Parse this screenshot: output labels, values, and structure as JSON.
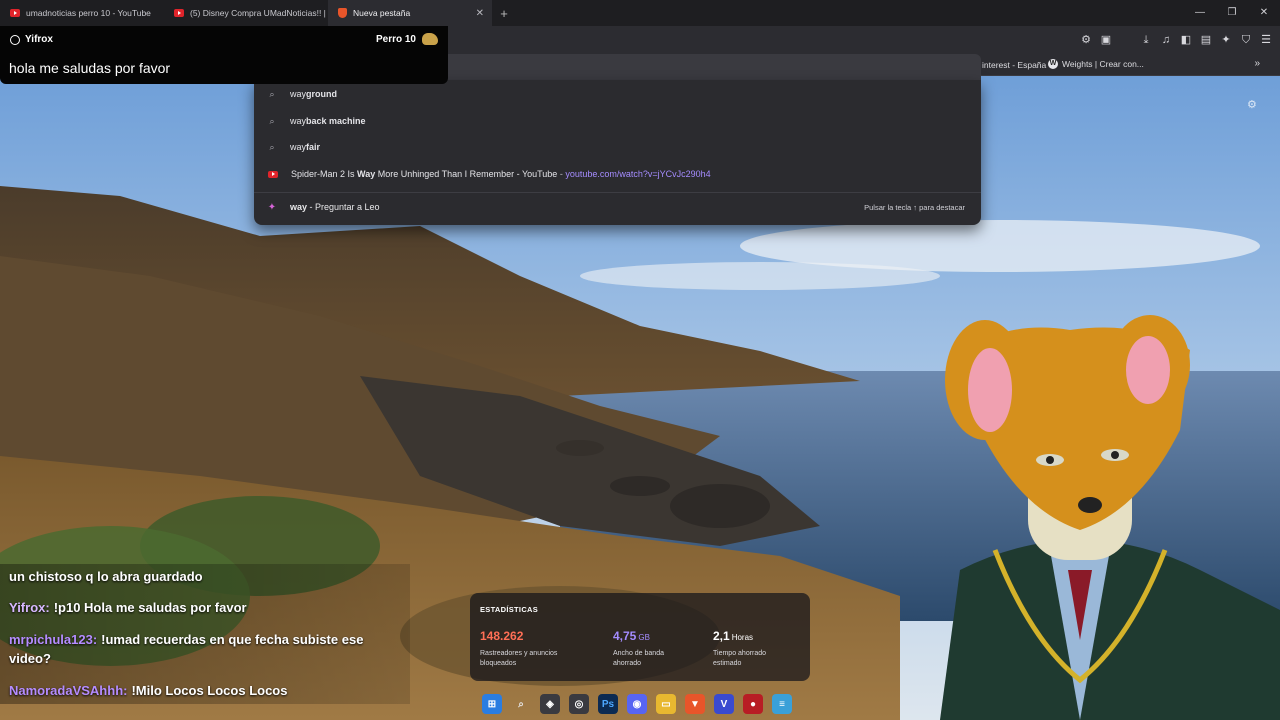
{
  "tabs": [
    {
      "label": "umadnoticias perro 10 - YouTube",
      "icon": "youtube-icon",
      "active": false
    },
    {
      "label": "(5) Disney Compra UMadNoticias!! |",
      "icon": "youtube-icon",
      "active": false
    },
    {
      "label": "Nueva pestaña",
      "icon": "brave-icon",
      "active": true
    }
  ],
  "bookmarks": {
    "item1": "interest - España",
    "item2": "Weights | Crear con..."
  },
  "chat_popup": {
    "user": "Yifrox",
    "reward": "Perro 10",
    "message": "hola me saludas por favor"
  },
  "suggestions": {
    "s1": {
      "prefix": "way",
      "completion": "ground"
    },
    "s2": {
      "prefix": "way",
      "completion": "back machine"
    },
    "s3": {
      "prefix": "way",
      "completion": "fair"
    },
    "s4": {
      "pre": "Spider-Man 2 Is ",
      "bold": "Way",
      "post": " More Unhinged Than I Remember - YouTube",
      "dash": " - ",
      "url": "youtube.com/watch?v=jYCvJc290h4"
    },
    "leo": {
      "query": "way",
      "dash": " - ",
      "action": "Preguntar a Leo",
      "hint": "Pulsar la tecla ↑ para destacar"
    }
  },
  "stats": {
    "title": "ESTADÍSTICAS",
    "trackers": {
      "value": "148.262",
      "desc_line1": "Rastreadores y anuncios",
      "desc_line2": "bloqueados"
    },
    "bandwidth": {
      "value": "4,75",
      "unit": "GB",
      "desc_line1": "Ancho de banda",
      "desc_line2": "ahorrado"
    },
    "time": {
      "value": "2,1",
      "unit": "Horas",
      "desc_line1": "Tiempo ahorrado",
      "desc_line2": "estimado"
    }
  },
  "chat_log": [
    {
      "nick": "",
      "text": "un chistoso q lo abra guardado"
    },
    {
      "nick": "Yifrox:",
      "text": "!p10 Hola me saludas por favor"
    },
    {
      "nick": "mrpichula123:",
      "text": "!umad recuerdas en que fecha subiste ese video?"
    },
    {
      "nick": "NamoradaVSAhhh:",
      "text": "!Milo Locos Locos Locos"
    }
  ],
  "colors": {
    "accent_purple": "#a48cff",
    "trackers_orange": "#ff6f56",
    "youtube_red": "#e0242b"
  }
}
